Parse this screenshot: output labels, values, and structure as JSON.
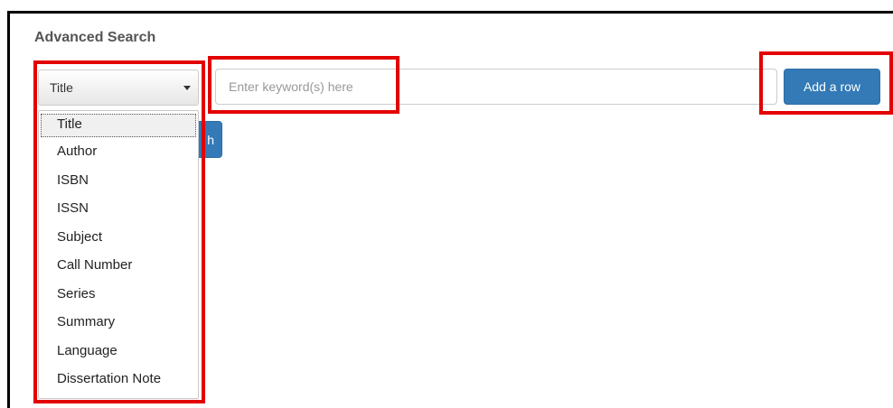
{
  "heading": "Advanced Search",
  "field_select": {
    "selected": "Title",
    "options": [
      "Title",
      "Author",
      "ISBN",
      "ISSN",
      "Subject",
      "Call Number",
      "Series",
      "Summary",
      "Language",
      "Dissertation Note"
    ]
  },
  "keyword_input": {
    "value": "",
    "placeholder": "Enter keyword(s) here"
  },
  "add_row_button": "Add a row",
  "search_button_visible_text": "h",
  "colors": {
    "primary_button": "#337ab7",
    "highlight": "#e20000"
  }
}
